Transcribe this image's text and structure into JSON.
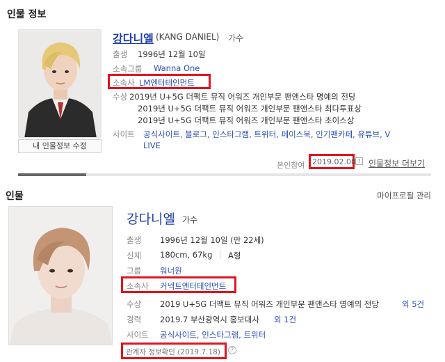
{
  "panel1": {
    "section_title": "인물 정보",
    "name": "강다니엘",
    "name_en": "(KANG DANIEL)",
    "occupation": "가수",
    "labels": {
      "birth": "출생",
      "group": "소속그룹",
      "agency": "소속사",
      "awards": "수상",
      "sites": "사이트"
    },
    "birth": "1996년 12월 10일",
    "group": "Wanna One",
    "agency": "LM엔터테인먼트",
    "awards": [
      "2019년 U+5G 더팩트 뮤직 어워즈 개인부문 팬앤스타 명예의 전당",
      "2019년 U+5G 더팩트 뮤직 어워즈 개인부문 팬앤스타 최다투표상",
      "2019년 U+5G 더팩트 뮤직 어워즈 개인부문 팬앤스타 초이스상"
    ],
    "sites": [
      "공식사이트",
      "블로그",
      "인스타그램",
      "트위터",
      "페이스북",
      "인기팬카페",
      "유튜브",
      "V LIVE"
    ],
    "sites_line1": "공식사이트, 블로그, 인스타그램, 트위터, 페이스북, 인기팬카페, 유튜브, V",
    "sites_line2": "LIVE",
    "edit_button": "내 인물정보 수정",
    "verify_label": "본인참여",
    "verify_date": "2019.02.08",
    "help_icon_glyph": "?",
    "more_link": "인물정보 더보기"
  },
  "panel2": {
    "section_title": "인물",
    "manage_link": "마이프로필 관리",
    "name": "강다니엘",
    "occupation": "가수",
    "labels": {
      "birth": "출생",
      "body": "신체",
      "group": "그룹",
      "agency": "소속사",
      "awards": "수상",
      "career": "경력",
      "sites": "사이트"
    },
    "birth": "1996년 12월 10일 (만 22세)",
    "body_size": "180cm, 67kg",
    "blood": "A형",
    "group": "워너원",
    "agency": "커넥트엔터테인먼트",
    "award": "2019 U+5G 더팩트 뮤직 어워즈 개인부문 팬앤스타 명예의 전당",
    "award_more": "외 5건",
    "career": "2019.7 부산광역시 홍보대사",
    "career_more": "외 1건",
    "sites": [
      "공식사이트",
      "인스타그램",
      "트위터"
    ],
    "sites_text": "공식사이트, 인스타그램, 트위터",
    "verify": "관계자 정보확인 (2019.7.18)",
    "help_icon_glyph": "?"
  },
  "colors": {
    "link": "#2a4fb5",
    "name": "#1d3fa5",
    "highlight_box": "#e1141e"
  }
}
